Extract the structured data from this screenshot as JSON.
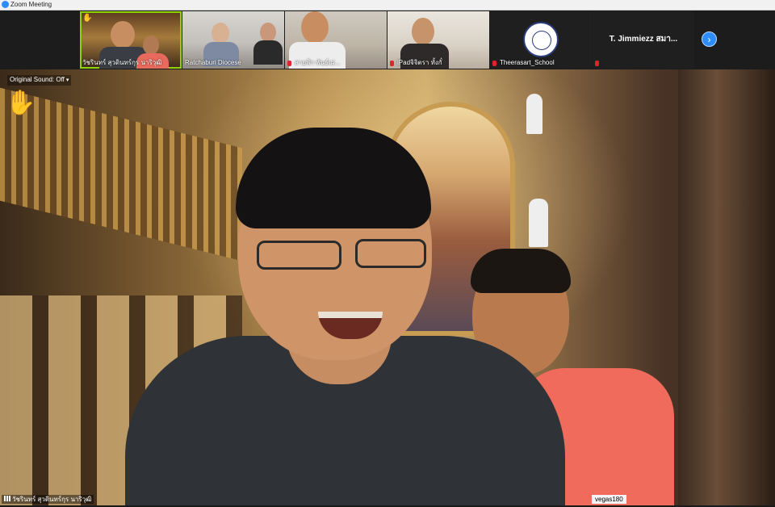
{
  "window": {
    "title": "Zoom Meeting"
  },
  "participants": [
    {
      "name": "วัชรินทร์ สุวดินทร์กุร นาริวุฒิ",
      "muted": false,
      "active": true,
      "raised_hand": true
    },
    {
      "name": "Ratchaburi Diocese",
      "muted": false
    },
    {
      "name": "สายฟ้า พันธ์เผ่...",
      "muted": true
    },
    {
      "name": "iPadจิจิตรา ทั้งกั๋",
      "muted": true
    },
    {
      "name": "Theerasart_School",
      "muted": true
    },
    {
      "name": "T. Jimmiezz สมา...",
      "muted": true
    }
  ],
  "main_video": {
    "original_sound": "Original Sound: Off",
    "speaker_name": "วัชรินทร์ สุวดินทร์กุร นาริวุฒิ",
    "watermark": "vegas180"
  },
  "icons": {
    "app": "zoom-icon",
    "raise_hand": "raised-hand-icon",
    "mic_muted": "mic-muted-icon",
    "next": "chevron-right-icon"
  },
  "colors": {
    "accent_blue": "#2d8cff",
    "active_speaker": "#8fd400",
    "muted_red": "#e0242c",
    "hand_yellow": "#f7c02e"
  }
}
